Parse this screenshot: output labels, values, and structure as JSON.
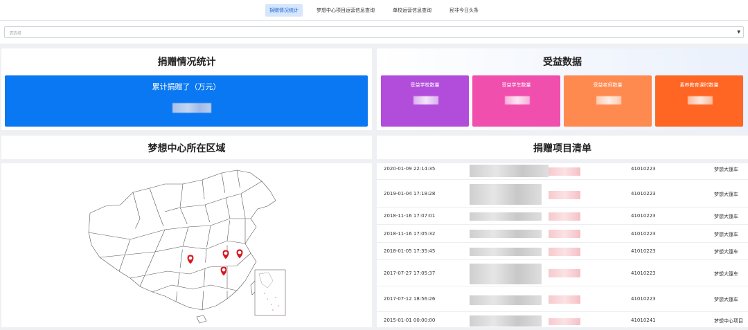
{
  "tabs": [
    {
      "label": "捐赠情况统计",
      "active": true
    },
    {
      "label": "梦想中心项目运营信息查询",
      "active": false
    },
    {
      "label": "单校运营信息查询",
      "active": false
    },
    {
      "label": "民非今日头条",
      "active": false
    }
  ],
  "select": {
    "placeholder": "请选择"
  },
  "donation": {
    "title": "捐赠情况统计",
    "total_label": "累计捐赠了（万元）"
  },
  "benefit": {
    "title": "受益数据",
    "cards": [
      {
        "label": "受益学校数量",
        "color": "#b24ddb"
      },
      {
        "label": "受益学生数量",
        "color": "#f04fad"
      },
      {
        "label": "受益老师数量",
        "color": "#ff8a50"
      },
      {
        "label": "素养教育课时数量",
        "color": "#ff6523"
      }
    ]
  },
  "map": {
    "title": "梦想中心所在区域"
  },
  "list": {
    "title": "捐赠项目清单",
    "rows": [
      {
        "date": "2020-01-09 22:14:35",
        "code": "41010223",
        "project": "梦想大篷车"
      },
      {
        "date": "2019-01-04 17:18:28",
        "code": "41010223",
        "project": "梦想大篷车"
      },
      {
        "date": "2018-11-16 17:07:01",
        "code": "41010223",
        "project": "梦想大篷车"
      },
      {
        "date": "2018-11-16 17:05:32",
        "code": "41010223",
        "project": "梦想大篷车"
      },
      {
        "date": "2018-01-05 17:35:45",
        "code": "41010223",
        "project": "梦想大篷车"
      },
      {
        "date": "2017-07-27 17:05:37",
        "code": "41010223",
        "project": "梦想大篷车"
      },
      {
        "date": "2017-07-12 18:56:26",
        "code": "41010223",
        "project": "梦想大篷车"
      },
      {
        "date": "2015-01-01 00:00:00",
        "code": "41010241",
        "project": "梦想中心项目"
      }
    ]
  }
}
